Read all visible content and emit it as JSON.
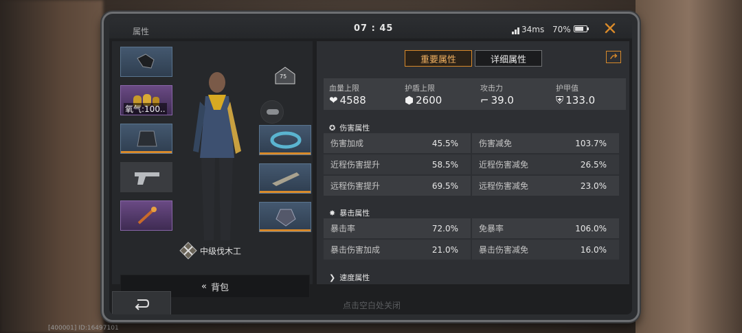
{
  "window": {
    "title": "属性",
    "clock": "07 : 45",
    "ping": "34ms",
    "battery_pct": "70%"
  },
  "equipment": {
    "oxygen_label": "氧气:100.."
  },
  "character": {
    "level": "75",
    "title": "中级伐木工"
  },
  "bag_button": {
    "label": "背包"
  },
  "hint": "点击空白处关闭",
  "tabs": [
    {
      "label": "重要属性",
      "active": true
    },
    {
      "label": "详细属性",
      "active": false
    }
  ],
  "summary": [
    {
      "label": "血量上限",
      "value": "4588",
      "icon": "heart-icon"
    },
    {
      "label": "护盾上限",
      "value": "2600",
      "icon": "shield-icon"
    },
    {
      "label": "攻击力",
      "value": "39.0",
      "icon": "gun-icon"
    },
    {
      "label": "护甲值",
      "value": "133.0",
      "icon": "armor-icon"
    }
  ],
  "sections": {
    "damage": {
      "title": "伤害属性",
      "rows": [
        [
          {
            "k": "伤害加成",
            "v": "45.5%"
          },
          {
            "k": "伤害减免",
            "v": "103.7%"
          }
        ],
        [
          {
            "k": "近程伤害提升",
            "v": "58.5%"
          },
          {
            "k": "近程伤害减免",
            "v": "26.5%"
          }
        ],
        [
          {
            "k": "远程伤害提升",
            "v": "69.5%"
          },
          {
            "k": "远程伤害减免",
            "v": "23.0%"
          }
        ]
      ]
    },
    "crit": {
      "title": "暴击属性",
      "rows": [
        [
          {
            "k": "暴击率",
            "v": "72.0%"
          },
          {
            "k": "免暴率",
            "v": "106.0%"
          }
        ],
        [
          {
            "k": "暴击伤害加成",
            "v": "21.0%"
          },
          {
            "k": "暴击伤害减免",
            "v": "16.0%"
          }
        ]
      ]
    },
    "speed": {
      "title": "速度属性"
    }
  },
  "debug": "[400001] ID:16497101",
  "colors": {
    "accent": "#d98a2a",
    "panel": "#2d2f33",
    "cell": "#3b3d41"
  }
}
